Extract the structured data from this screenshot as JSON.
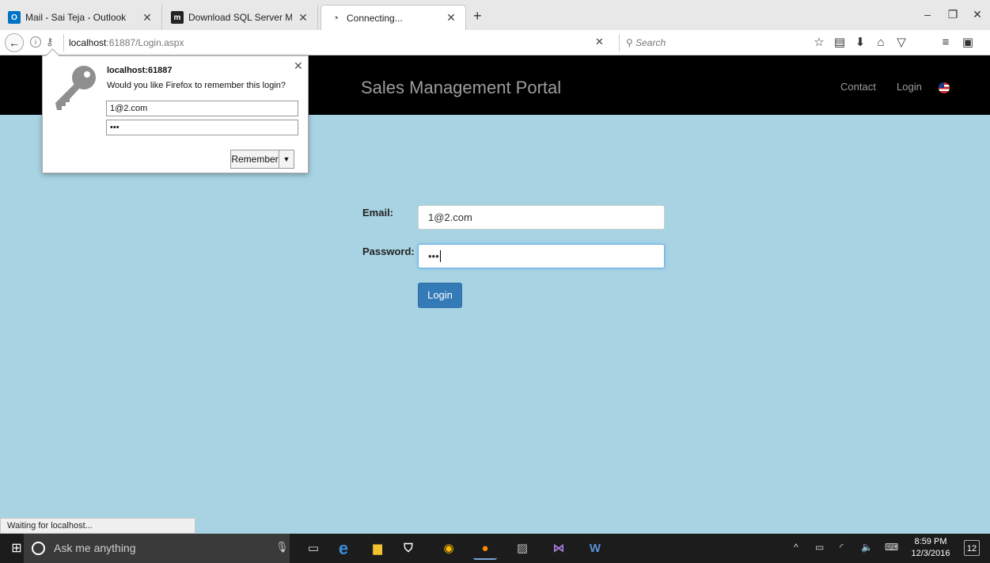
{
  "browser": {
    "tabs": [
      {
        "favicon": "outlook-icon",
        "favicon_text": "O",
        "title": "Mail - Sai Teja - Outlook",
        "active": false
      },
      {
        "favicon": "m-site-icon",
        "favicon_text": "m",
        "title": "Download SQL Server Ma...",
        "active": false
      },
      {
        "favicon": "loading-spinner-icon",
        "favicon_text": "◔",
        "title": "Connecting...",
        "active": true
      }
    ],
    "new_tab": "+",
    "window_controls": {
      "minimize": "–",
      "restore": "❐",
      "close": "✕"
    },
    "url_host": "localhost",
    "url_rest": ":61887/Login.aspx",
    "url_stop": "✕",
    "search_placeholder": "Search"
  },
  "password_popup": {
    "host": "localhost:61887",
    "question": "Would you like Firefox to remember this login?",
    "username": "1@2.com",
    "password_mask": "•••",
    "remember_label": "Remember",
    "close": "✕"
  },
  "site": {
    "title": "Sales Management Portal",
    "nav": {
      "contact": "Contact",
      "login": "Login"
    }
  },
  "login_form": {
    "email_label": "Email:",
    "email_value": "1@2.com",
    "password_label": "Password:",
    "password_mask": "•••",
    "submit_label": "Login"
  },
  "status_text": "Waiting for localhost...",
  "taskbar": {
    "search_placeholder": "Ask me anything",
    "time": "8:59 PM",
    "date": "12/3/2016",
    "notification_count": "12",
    "colors": {
      "accent": "#337ab7",
      "page_background": "#a8d3e3",
      "header": "#000000"
    }
  }
}
